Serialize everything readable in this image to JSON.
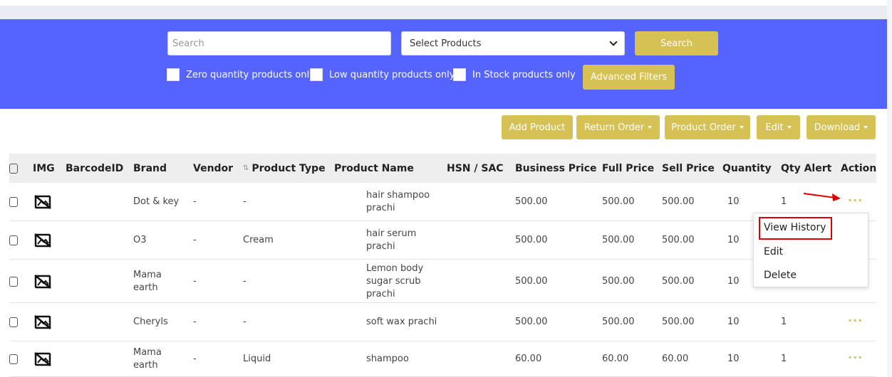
{
  "filters": {
    "search_placeholder": "Search",
    "select_products": "Select Products",
    "search_button": "Search",
    "advanced_filters": "Advanced Filters",
    "checkboxes": [
      "Zero quantity products only",
      "Low quantity products only",
      "In Stock products only"
    ]
  },
  "toolbar": {
    "add_product": "Add Product",
    "return_order": "Return Order",
    "product_order": "Product Order",
    "edit": "Edit",
    "download": "Download"
  },
  "table": {
    "columns": [
      "IMG",
      "BarcodeID",
      "Brand",
      "Vendor",
      "Product Type",
      "Product Name",
      "HSN / SAC",
      "Business Price",
      "Full Price",
      "Sell Price",
      "Quantity",
      "Qty Alert",
      "Action"
    ],
    "rows": [
      {
        "brand": [
          "Dot & key"
        ],
        "vendor": "-",
        "type": "-",
        "name": [
          "hair shampoo",
          "prachi"
        ],
        "business": "500.00",
        "full": "500.00",
        "sell": "500.00",
        "qty": "10",
        "alert": "1"
      },
      {
        "brand": [
          "O3"
        ],
        "vendor": "-",
        "type": "Cream",
        "name": [
          "hair serum",
          "prachi"
        ],
        "business": "500.00",
        "full": "500.00",
        "sell": "500.00",
        "qty": "10",
        "alert": ""
      },
      {
        "brand": [
          "Mama",
          "earth"
        ],
        "vendor": "-",
        "type": "-",
        "name": [
          "Lemon body",
          "sugar scrub",
          "prachi"
        ],
        "business": "500.00",
        "full": "500.00",
        "sell": "500.00",
        "qty": "10",
        "alert": ""
      },
      {
        "brand": [
          "Cheryls"
        ],
        "vendor": "-",
        "type": "-",
        "name": [
          "soft wax prachi"
        ],
        "business": "500.00",
        "full": "500.00",
        "sell": "500.00",
        "qty": "10",
        "alert": "1"
      },
      {
        "brand": [
          "Mama",
          "earth"
        ],
        "vendor": "-",
        "type": "Liquid",
        "name": [
          "shampoo"
        ],
        "business": "60.00",
        "full": "60.00",
        "sell": "60.00",
        "qty": "10",
        "alert": "1"
      }
    ],
    "action_dots": "···"
  },
  "action_menu": {
    "items": [
      "View History",
      "Edit",
      "Delete"
    ]
  },
  "colors": {
    "panel": "#5563ff",
    "gold": "#d5c154",
    "highlight": "#e00000"
  }
}
